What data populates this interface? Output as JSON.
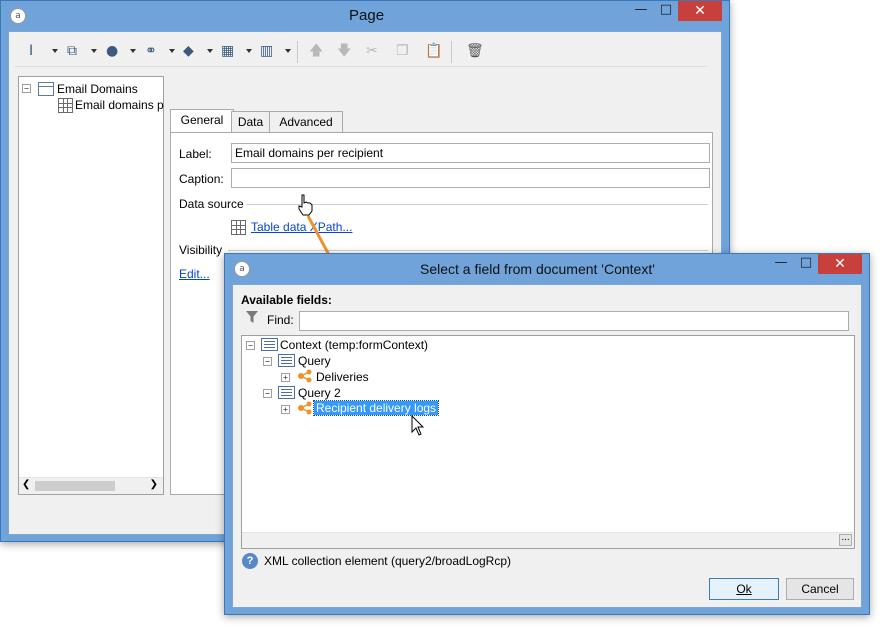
{
  "page_window": {
    "title": "Page",
    "app_icon": "app-logo-icon",
    "minimize": "—",
    "maximize": "□",
    "close": "✕"
  },
  "toolbar": {
    "icons": [
      "text-cursor-icon",
      "input-field-icon",
      "globe-icon",
      "link-icon",
      "layers-icon",
      "grid-icon",
      "columns-icon",
      "move-up-icon",
      "move-down-icon",
      "cut-icon",
      "copy-icon",
      "paste-icon",
      "delete-icon"
    ]
  },
  "tree": {
    "root_label": "Email Domains",
    "child_label": "Email domains p"
  },
  "tabs": [
    "General",
    "Data",
    "Advanced"
  ],
  "general": {
    "label_caption": "Label:",
    "label_value": "Email domains per recipient",
    "caption_caption": "Caption:",
    "caption_value": "",
    "datasource_heading": "Data source",
    "datasource_link": "Table data XPath...",
    "visibility_heading": "Visibility",
    "edit_link": "Edit..."
  },
  "dialog": {
    "title": "Select a field from document 'Context'",
    "available_fields": "Available fields:",
    "find_label": "Find:",
    "find_value": "",
    "tree": {
      "root": "Context (temp:formContext)",
      "query1": "Query",
      "deliveries": "Deliveries",
      "query2": "Query 2",
      "recipient_logs": "Recipient delivery logs"
    },
    "status_text": "XML collection element (query2/broadLogRcp)",
    "ok_label": "Ok",
    "cancel_label": "Cancel",
    "more_button": "..."
  },
  "colors": {
    "window_frame": "#6fa3d9",
    "close_button": "#c8403c",
    "link": "#0645c8",
    "selection": "#3399ff",
    "arrow": "#f0922b",
    "node_orange": "#f0922b"
  }
}
